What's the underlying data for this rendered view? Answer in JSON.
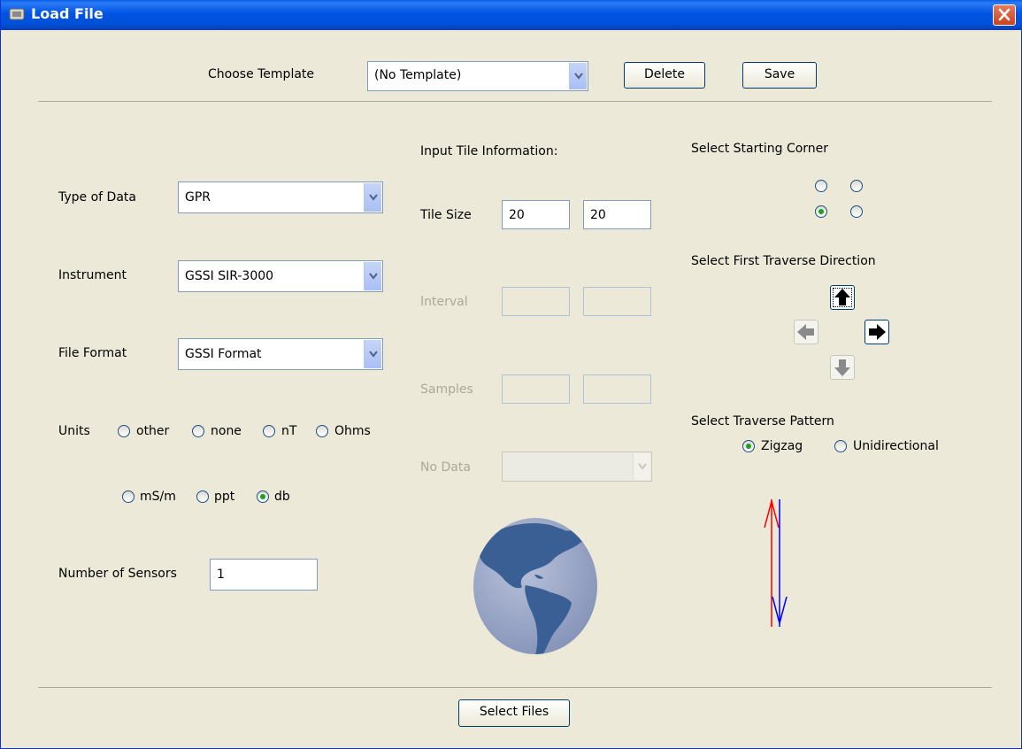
{
  "window": {
    "title": "Load File"
  },
  "template": {
    "label": "Choose Template",
    "value": "(No Template)",
    "delete_label": "Delete",
    "save_label": "Save"
  },
  "left": {
    "type_label": "Type of Data",
    "type_value": "GPR",
    "instrument_label": "Instrument",
    "instrument_value": "GSSI SIR-3000",
    "format_label": "File Format",
    "format_value": "GSSI Format",
    "units_label": "Units",
    "units_options": [
      "other",
      "none",
      "nT",
      "Ohms",
      "mS/m",
      "ppt",
      "db"
    ],
    "units_selected": "db",
    "sensors_label": "Number of Sensors",
    "sensors_value": "1"
  },
  "middle": {
    "heading": "Input Tile Information:",
    "tile_size_label": "Tile Size",
    "tile_x": "20",
    "tile_y": "20",
    "interval_label": "Interval",
    "samples_label": "Samples",
    "nodata_label": "No Data"
  },
  "right": {
    "corner_label": "Select Starting Corner",
    "corner_selected": "bottom-left",
    "direction_label": "Select First Traverse Direction",
    "direction_selected": "up",
    "pattern_label": "Select Traverse Pattern",
    "pattern_options": [
      "Zigzag",
      "Unidirectional"
    ],
    "pattern_selected": "Zigzag"
  },
  "footer": {
    "select_files_label": "Select Files"
  },
  "colors": {
    "titlebar": "#0054e3",
    "radio_dot": "#21a121",
    "globe_land": "#3a5f95",
    "globe_sea": "#9aa8c8",
    "arrow_up": "#ff0000",
    "arrow_down": "#0000ff"
  }
}
